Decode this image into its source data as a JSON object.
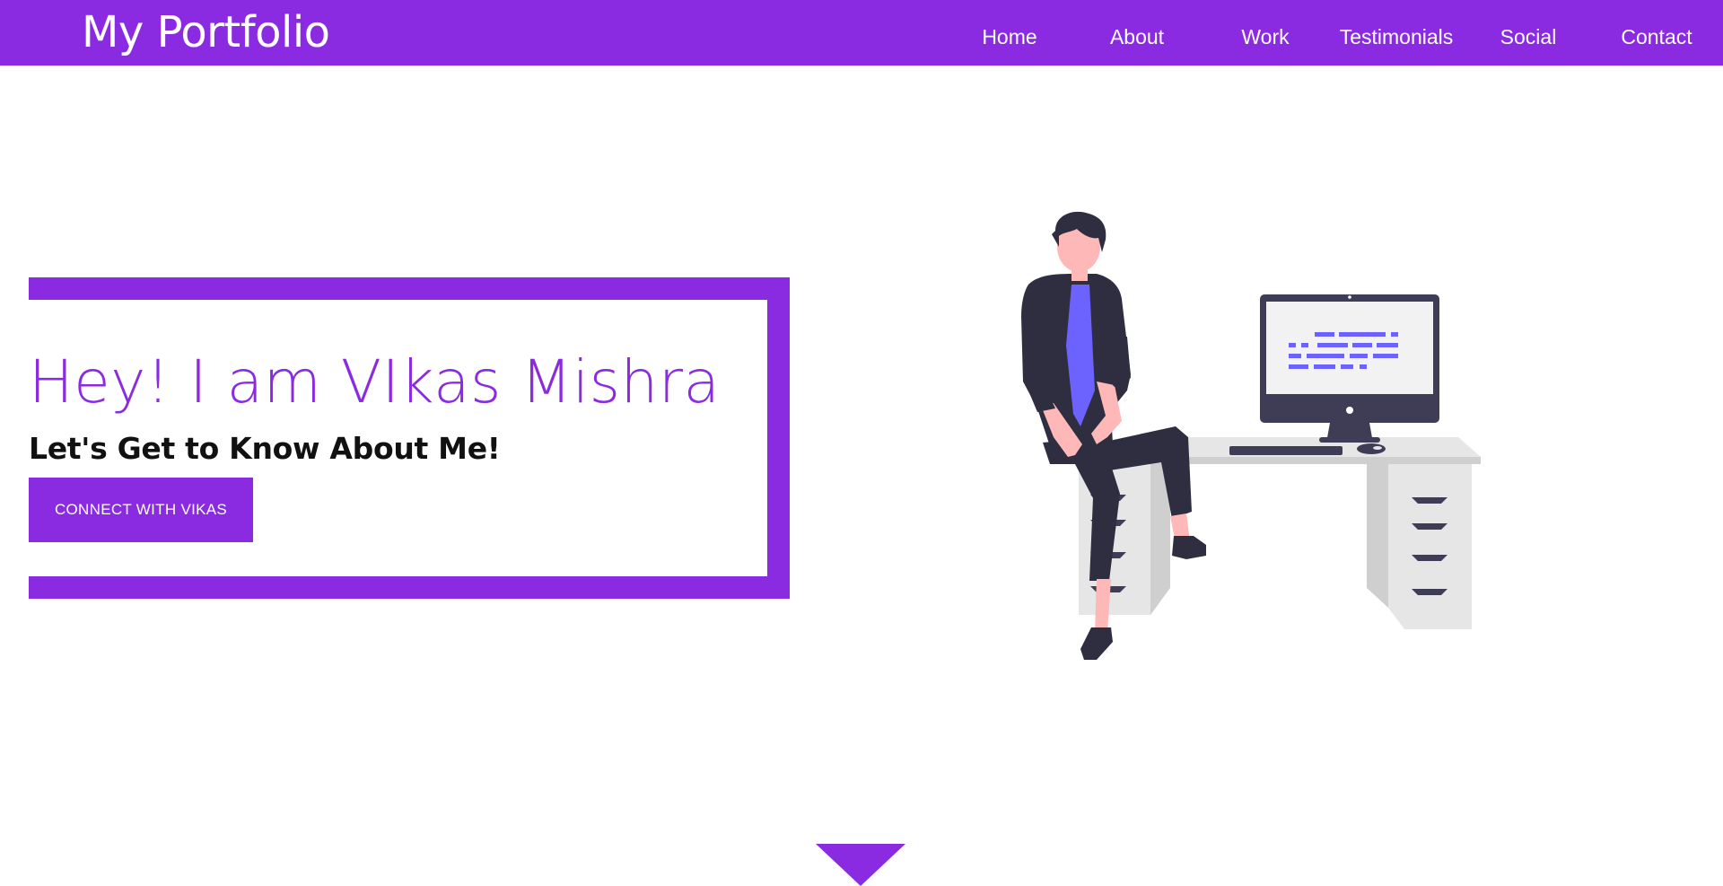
{
  "header": {
    "brand": "My Portfolio",
    "nav": [
      "Home",
      "About",
      "Work",
      "Testimonials",
      "Social",
      "Contact"
    ]
  },
  "hero": {
    "title": "Hey! I am VIkas Mishra",
    "subtitle": "Let's Get to Know About Me!",
    "cta_label": "CONNECT WITH VIKAS"
  },
  "illustration": {
    "icon": "person-at-desk-illustration"
  },
  "scroll_indicator": {
    "icon": "down-triangle-icon"
  },
  "colors": {
    "accent": "#8a2be2",
    "navbar_bg": "#8a2be2",
    "text_dark": "#111111",
    "illustration_dark": "#2f2e41",
    "illustration_purple": "#6c63ff",
    "desk_gray": "#e6e6e6",
    "skin": "#ffb8b8"
  }
}
